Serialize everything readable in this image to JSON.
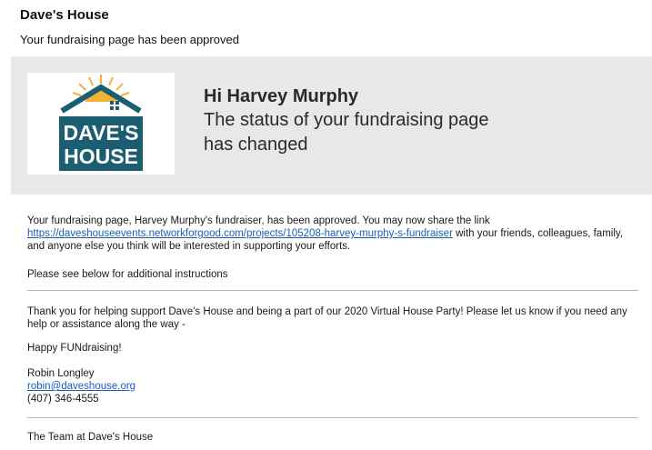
{
  "header": {
    "sender": "Dave's House",
    "subject": "Your fundraising page has been approved"
  },
  "email": {
    "logo": {
      "line1": "DAVE'S",
      "line2": "HOUSE",
      "brand_color": "#1b5e72",
      "sun_color": "#f2b233"
    },
    "greeting": "Hi Harvey Murphy",
    "status_line": "The status of your fundraising page has changed",
    "body": {
      "approved_text_before": "Your fundraising page, Harvey Murphy's fundraiser, has been approved. You may now share the link",
      "project_link": "https://daveshouseevents.networkforgood.com/projects/105208-harvey-murphy-s-fundraiser",
      "approved_text_after": "with your friends, colleagues, family, and anyone else you think will be interested in supporting your efforts.",
      "instructions": "Please see below for additional instructions",
      "thanks": "Thank you for helping support Dave's House and being a part of our 2020 Virtual House Party! Please let us know if you need any help or assistance along the way -",
      "sign_off": "Happy FUNdraising!",
      "signature": {
        "name": "Robin Longley",
        "email": "robin@daveshouse.org",
        "phone": "(407) 346-4555"
      },
      "team": "The Team at Dave's House"
    }
  },
  "colors": {
    "link": "#1a5fb4",
    "header_bg": "#e8e8e8"
  }
}
